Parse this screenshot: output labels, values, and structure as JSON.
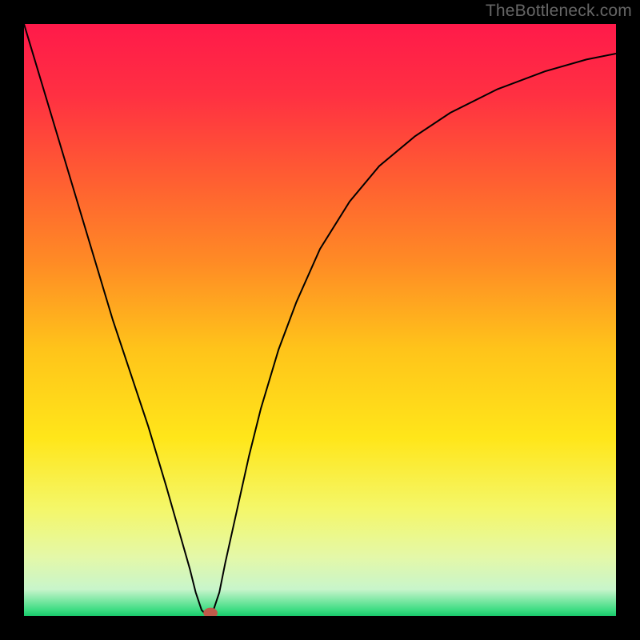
{
  "watermark": "TheBottleneck.com",
  "chart_data": {
    "type": "line",
    "title": "",
    "xlabel": "",
    "ylabel": "",
    "xlim": [
      0,
      100
    ],
    "ylim": [
      0,
      100
    ],
    "grid": false,
    "legend": false,
    "background_gradient": {
      "stops": [
        {
          "offset": 0.0,
          "color": "#ff1a4a"
        },
        {
          "offset": 0.12,
          "color": "#ff3042"
        },
        {
          "offset": 0.25,
          "color": "#ff5a33"
        },
        {
          "offset": 0.4,
          "color": "#ff8a25"
        },
        {
          "offset": 0.55,
          "color": "#ffc41a"
        },
        {
          "offset": 0.7,
          "color": "#ffe61a"
        },
        {
          "offset": 0.82,
          "color": "#f4f76a"
        },
        {
          "offset": 0.9,
          "color": "#e4f8a8"
        },
        {
          "offset": 0.955,
          "color": "#c8f5cb"
        },
        {
          "offset": 0.99,
          "color": "#3cdc82"
        },
        {
          "offset": 1.0,
          "color": "#19c96b"
        }
      ]
    },
    "series": [
      {
        "name": "bottleneck-curve",
        "color": "#000000",
        "width": 2,
        "x": [
          0,
          3,
          6,
          9,
          12,
          15,
          18,
          21,
          24,
          26,
          28,
          29,
          30,
          31,
          32,
          33,
          34,
          36,
          38,
          40,
          43,
          46,
          50,
          55,
          60,
          66,
          72,
          80,
          88,
          95,
          100
        ],
        "y": [
          100,
          90,
          80,
          70,
          60,
          50,
          41,
          32,
          22,
          15,
          8,
          4,
          1,
          0,
          1,
          4,
          9,
          18,
          27,
          35,
          45,
          53,
          62,
          70,
          76,
          81,
          85,
          89,
          92,
          94,
          95
        ]
      }
    ],
    "marker": {
      "name": "optimal-point",
      "x": 31.5,
      "y": 0.5,
      "rx": 1.2,
      "ry": 0.9,
      "color": "#c05a4a"
    }
  }
}
